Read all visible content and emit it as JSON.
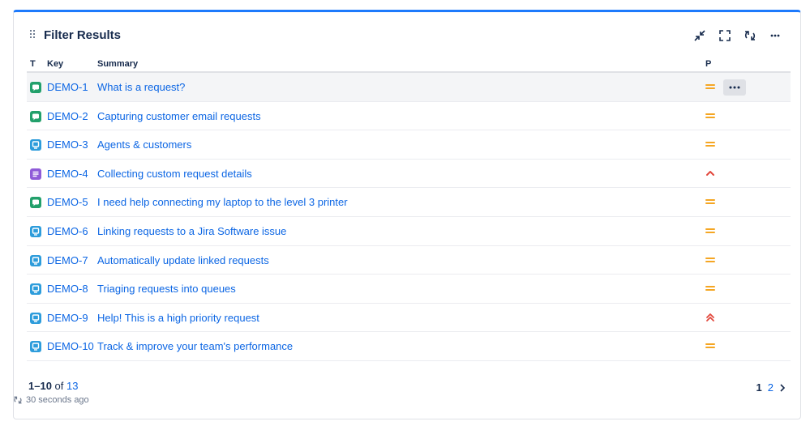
{
  "gadget": {
    "title": "Filter Results",
    "actions": [
      "minimize-icon",
      "fullscreen-icon",
      "refresh-icon",
      "more-icon"
    ]
  },
  "table": {
    "columns": {
      "type": "T",
      "key": "Key",
      "summary": "Summary",
      "priority": "P"
    },
    "rows": [
      {
        "type": "question",
        "key": "DEMO-1",
        "summary": "What is a request?",
        "priority": "medium"
      },
      {
        "type": "question",
        "key": "DEMO-2",
        "summary": "Capturing customer email requests",
        "priority": "medium"
      },
      {
        "type": "service",
        "key": "DEMO-3",
        "summary": "Agents & customers",
        "priority": "medium"
      },
      {
        "type": "task",
        "key": "DEMO-4",
        "summary": "Collecting custom request details",
        "priority": "high"
      },
      {
        "type": "question",
        "key": "DEMO-5",
        "summary": "I need help connecting my laptop to the level 3 printer",
        "priority": "medium"
      },
      {
        "type": "service",
        "key": "DEMO-6",
        "summary": "Linking requests to a Jira Software issue",
        "priority": "medium"
      },
      {
        "type": "service",
        "key": "DEMO-7",
        "summary": "Automatically update linked requests",
        "priority": "medium"
      },
      {
        "type": "service",
        "key": "DEMO-8",
        "summary": "Triaging requests into queues",
        "priority": "medium"
      },
      {
        "type": "service",
        "key": "DEMO-9",
        "summary": "Help! This is a high priority request",
        "priority": "highest"
      },
      {
        "type": "service",
        "key": "DEMO-10",
        "summary": "Track & improve your team's performance",
        "priority": "medium"
      }
    ]
  },
  "footer": {
    "range": "1–10",
    "of": "of",
    "total": "13",
    "pages": [
      "1",
      "2"
    ],
    "current_page": "1",
    "refreshed": "30 seconds ago"
  },
  "colors": {
    "accent": "#1d7afc",
    "link": "#0c66e4",
    "question": "#22a06b",
    "service": "#2d9cdb",
    "task": "#8f5bd8",
    "medium": "#f5a623",
    "high": "#e2483d"
  }
}
